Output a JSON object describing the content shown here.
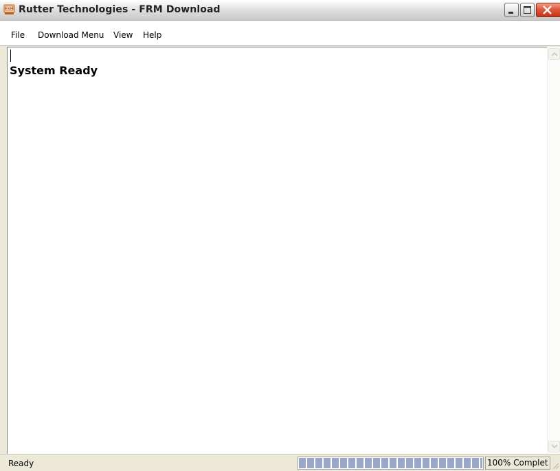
{
  "window": {
    "title": "Rutter Technologies - FRM Download",
    "icon": "frm-app-icon",
    "controls": [
      "minimize-icon",
      "maximize-icon",
      "close-icon"
    ]
  },
  "menu": {
    "items": [
      "File",
      "Download Menu",
      "View",
      "Help"
    ]
  },
  "content": {
    "log_line": "System Ready"
  },
  "statusbar": {
    "status": "Ready",
    "progress_percent": 100,
    "progress_label": "100% Complet"
  },
  "colors": {
    "progress_block": "#9aa7c9",
    "close_button": "#e0573a"
  }
}
